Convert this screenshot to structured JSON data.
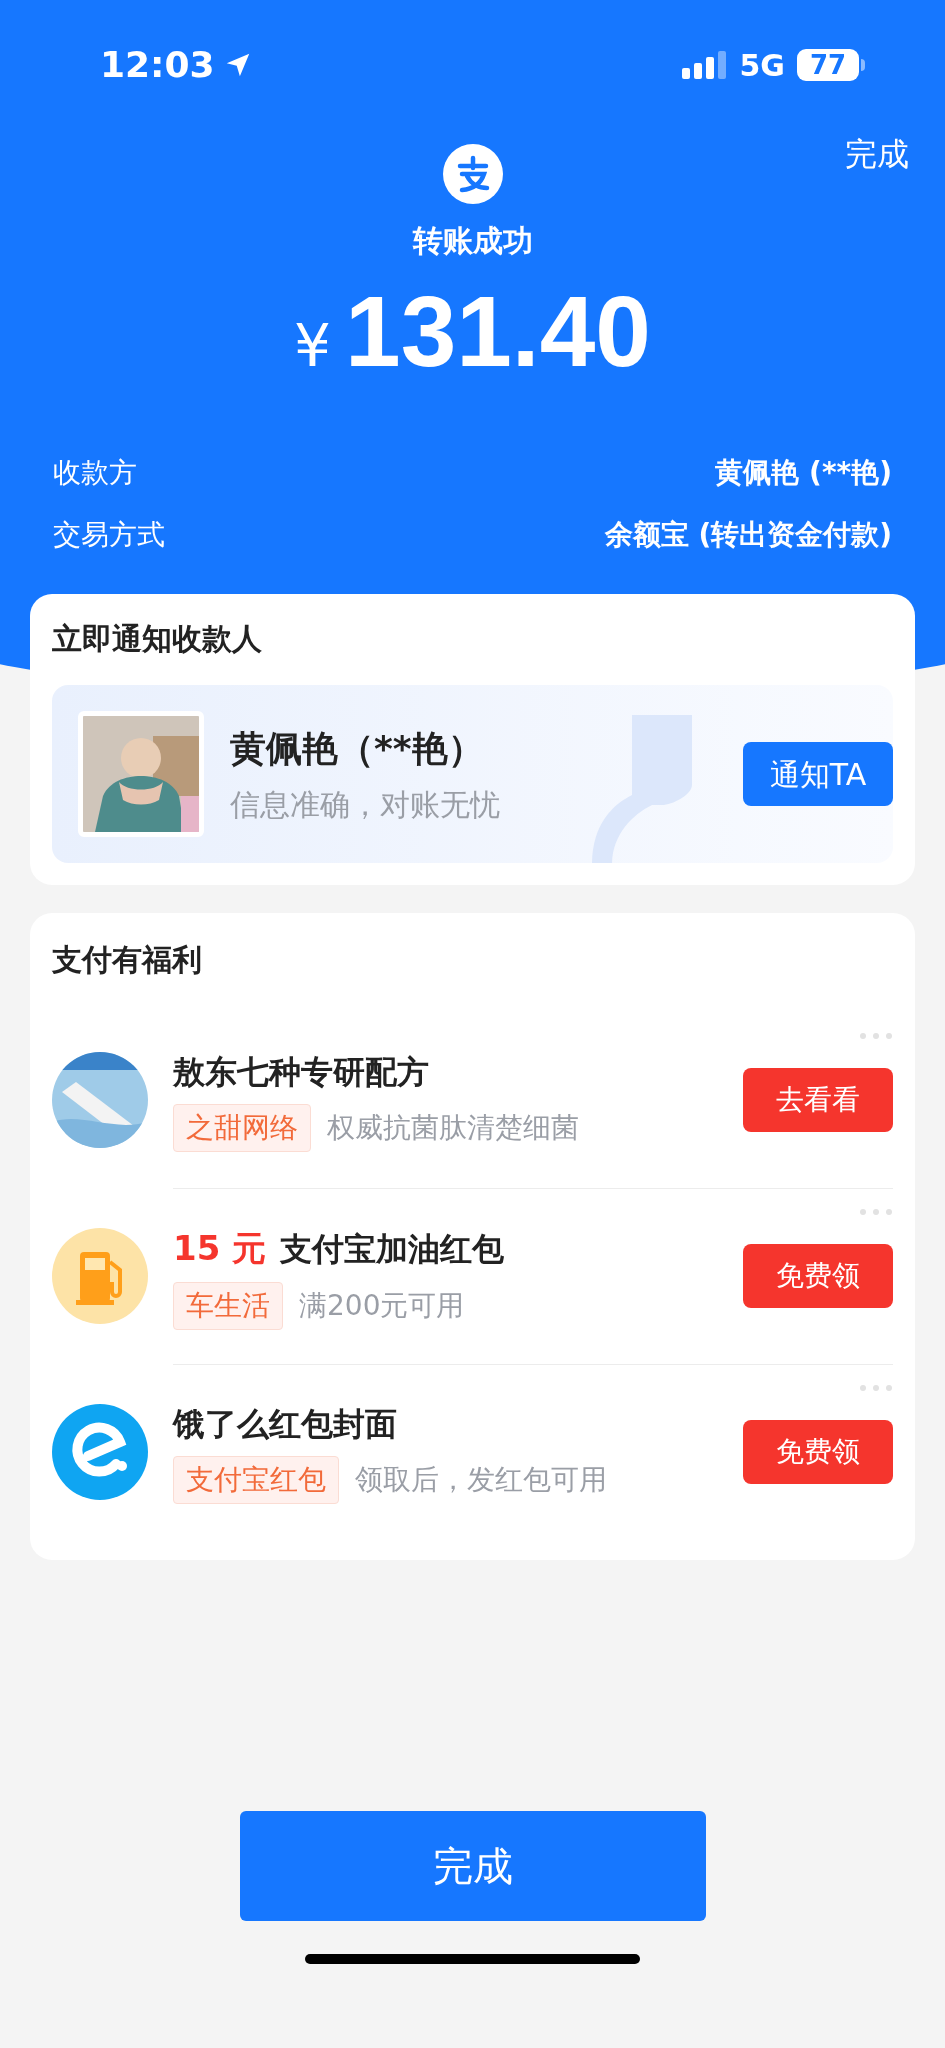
{
  "status_bar": {
    "time": "12:03",
    "network": "5G",
    "battery": "77"
  },
  "header": {
    "done_link": "完成",
    "title": "转账成功",
    "currency": "¥",
    "amount": "131.40"
  },
  "details": [
    {
      "label": "收款方",
      "value": "黄佩艳 (**艳)"
    },
    {
      "label": "交易方式",
      "value": "余额宝 (转出资金付款)"
    }
  ],
  "notify_card": {
    "title": "立即通知收款人",
    "name": "黄佩艳（**艳）",
    "subtitle": "信息准确，对账无忧",
    "button": "通知TA"
  },
  "benefits": {
    "title": "支付有福利",
    "items": [
      {
        "kind": "product",
        "title": "敖东七种专研配方",
        "tag": "之甜网络",
        "description": "权威抗菌肽清楚细菌",
        "button": "去看看"
      },
      {
        "kind": "fuel",
        "highlight": "15 元",
        "title": "支付宝加油红包",
        "tag": "车生活",
        "description": "满200元可用",
        "button": "免费领"
      },
      {
        "kind": "eleme",
        "title": "饿了么红包封面",
        "tag": "支付宝红包",
        "description": "领取后，发红包可用",
        "button": "免费领"
      }
    ]
  },
  "bottom_button": "完成"
}
